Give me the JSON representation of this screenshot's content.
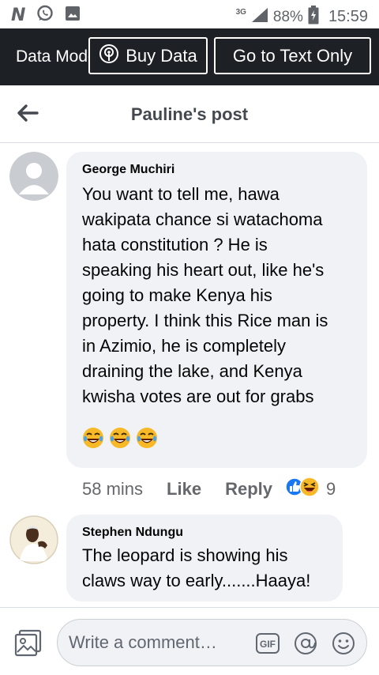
{
  "status_bar": {
    "app_letter": "N",
    "network": "3G",
    "battery_percent": "88%",
    "time": "15:59",
    "icons": [
      "n-app-icon",
      "whatsapp-icon",
      "gallery-icon",
      "signal-icon",
      "battery-icon"
    ]
  },
  "data_bar": {
    "mode_label": "Data Mode",
    "buy_label": "Buy Data",
    "text_only_label": "Go to Text Only"
  },
  "header": {
    "title": "Pauline's post"
  },
  "comments": [
    {
      "author": "George Muchiri",
      "lines": [
        "You want to tell me,  hawa",
        "wakipata chance si watachoma",
        "hata constitution ? He is",
        "speaking his heart out,  like he's",
        "going to make Kenya his",
        "property. I think this Rice man is",
        "in Azimio,  he is completely",
        "draining the lake, and Kenya",
        "kwisha votes are out for grabs"
      ],
      "emojis": "😂😂😂",
      "time": "58 mins",
      "like_label": "Like",
      "reply_label": "Reply",
      "reaction_count": "9",
      "reaction_icons": [
        "like-reaction-icon",
        "haha-reaction-icon"
      ]
    },
    {
      "author": "Stephen Ndungu",
      "lines": [
        "The leopard is showing his",
        "claws way to early.......Haaya!"
      ]
    }
  ],
  "composer": {
    "placeholder": "Write a comment…",
    "gif_label": "GIF"
  },
  "colors": {
    "data_bar_bg": "#1d2025",
    "bubble_bg": "#f0f2f5",
    "like_blue": "#1877f2",
    "haha_yellow": "#f7b928"
  }
}
